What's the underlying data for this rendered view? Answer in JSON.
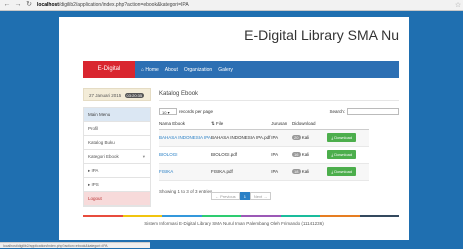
{
  "browser": {
    "host": "localhost",
    "path": "/digilib2/application/index.php?action=ebook&kategori=IPA"
  },
  "header": {
    "title": "E-Digital Library SMA Nu"
  },
  "menu": {
    "brand": "E-Digital Library",
    "items": [
      "Home",
      "About",
      "Organization",
      "Galery"
    ]
  },
  "sidebar": {
    "date": "27 Januari 2015",
    "time": "03:20:35",
    "items": [
      "Main Menu",
      "Profil",
      "Katalog Buku",
      "Kategori Ebook",
      "▸ IPA",
      "▸ IPS",
      "Logout"
    ]
  },
  "content": {
    "title": "Katalog Ebook",
    "records_value": "10",
    "records_label": "records per page",
    "search_label": "Search:",
    "columns": [
      "Nama Ebook",
      "File",
      "Jurusan",
      "Didownload",
      ""
    ],
    "rows": [
      {
        "name": "BAHASA INDONESIA IPA",
        "file": "BAHASA INDONESIA IPA.pdf",
        "jurusan": "IPA",
        "count": "20",
        "unit": "Kali",
        "action": "Download"
      },
      {
        "name": "BIOLOGI",
        "file": "BIOLOGI.pdf",
        "jurusan": "IPA",
        "count": "16",
        "unit": "Kali",
        "action": "Download"
      },
      {
        "name": "FISIKA",
        "file": "FISIKA.pdf",
        "jurusan": "IPA",
        "count": "18",
        "unit": "Kali",
        "action": "Download"
      }
    ],
    "info": "Showing 1 to 3 of 3 entries",
    "pager": {
      "prev": "← Previous",
      "current": "1",
      "next": "Next →"
    }
  },
  "strip_colors": [
    "#e84c3d",
    "#f1c40f",
    "#3498db",
    "#2ecc71",
    "#9b59b6",
    "#1abc9c",
    "#e67e22",
    "#34495e"
  ],
  "footer": "Sistem Informasi E-Digital Library SMA Nurul Iman Palembang Oleh Frimando (11141236)",
  "statusbar": "localhost/digilib2/application/index.php?action=ebook&kategori=IPA"
}
